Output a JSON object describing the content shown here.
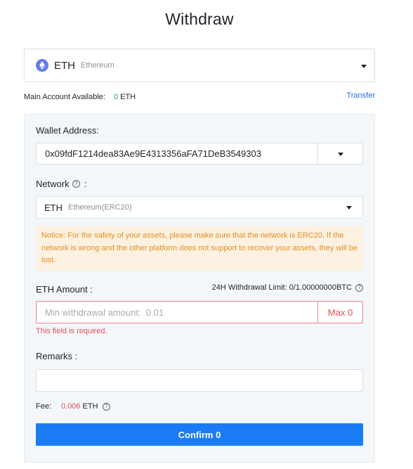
{
  "page": {
    "title": "Withdraw"
  },
  "coin": {
    "symbol": "ETH",
    "name": "Ethereum",
    "icon": "ethereum-icon",
    "icon_color": "#627eea"
  },
  "account": {
    "label": "Main Account Available:",
    "available": "0",
    "unit": "ETH",
    "transfer_label": "Transfer"
  },
  "wallet": {
    "label": "Wallet Address:",
    "address": "0x09fdF1214dea83Ae9E4313356aFA71DeB3549303"
  },
  "network": {
    "label": "Network",
    "colon": ":",
    "symbol": "ETH",
    "name": "Ethereum(ERC20)"
  },
  "notice": {
    "text": "Notice: For the safety of your assets, please make sure that the network is ERC20. If the network is wrong and the other platform does not support to recover your assets, they will be lost."
  },
  "amount": {
    "label": "ETH Amount :",
    "limit": "24H Withdrawal Limit: 0/1.00000000BTC",
    "placeholder": "Min withdrawal amount:  0.01",
    "max_label": "Max 0",
    "error": "This field is required."
  },
  "remarks": {
    "label": "Remarks :",
    "value": ""
  },
  "fee": {
    "label": "Fee:",
    "value": "0.006",
    "unit": "ETH"
  },
  "confirm": {
    "label": "Confirm 0"
  },
  "colors": {
    "accent": "#1a7cf5",
    "error": "#e84b5a",
    "success": "#17a673",
    "warning_bg": "#fdf1e2",
    "warning_text": "#e0901e"
  }
}
